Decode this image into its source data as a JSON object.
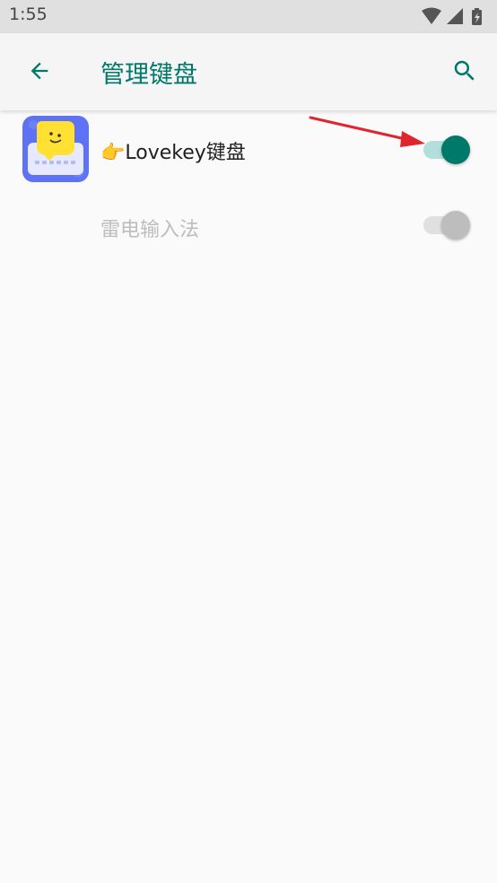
{
  "status_bar": {
    "time": "1:55",
    "icons": [
      "wifi-icon",
      "signal-icon",
      "battery-charging-icon"
    ]
  },
  "app_bar": {
    "title": "管理键盘",
    "back_icon": "arrow-back-icon",
    "search_icon": "search-icon",
    "accent_color": "#00796b"
  },
  "keyboards": [
    {
      "label": "👉Lovekey键盘",
      "enabled": true,
      "icon": "lovekey-app-icon"
    },
    {
      "label": "雷电输入法",
      "enabled": false,
      "disabled": true
    }
  ],
  "annotation": {
    "type": "red-arrow",
    "color": "#e0262c",
    "points_to": "toggle-lovekey"
  }
}
